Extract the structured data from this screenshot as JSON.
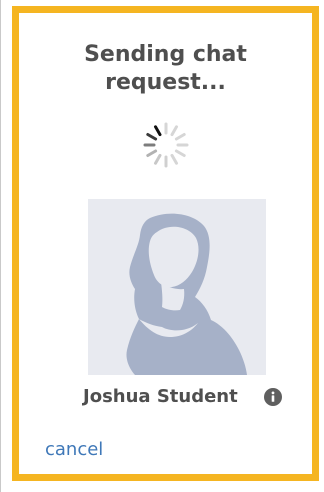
{
  "dialog": {
    "title_line1": "Sending chat",
    "title_line2": "request...",
    "contact_name": "Joshua Student",
    "cancel_label": "cancel"
  },
  "icons": {
    "spinner": "loading-spinner-icon",
    "avatar": "default-profile-silhouette",
    "info": "info-icon"
  },
  "colors": {
    "border": "#f5b521",
    "title_text": "#4f4f4f",
    "link": "#3f78b8",
    "avatar_background": "#e8eaf0",
    "avatar_silhouette": "#a6b1c8"
  }
}
